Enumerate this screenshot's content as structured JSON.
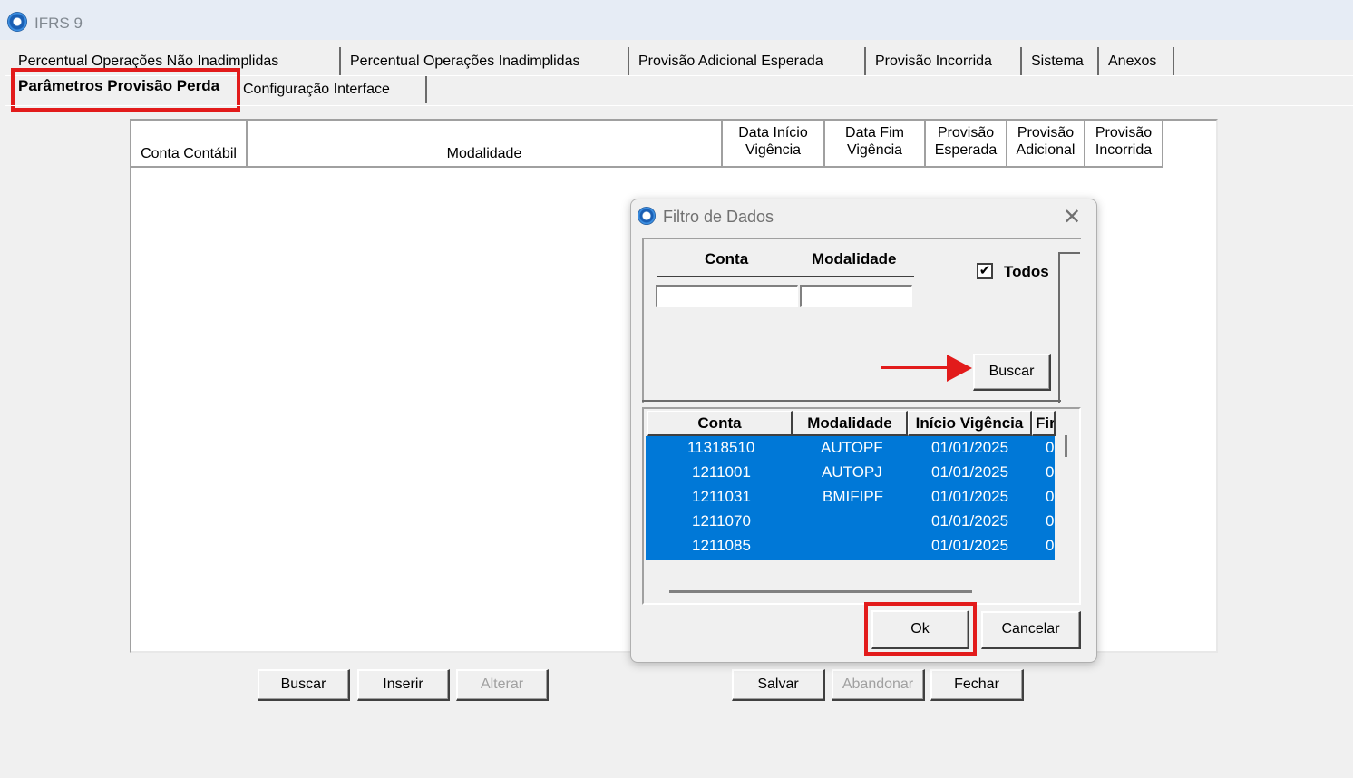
{
  "window": {
    "title": "IFRS 9"
  },
  "tabs": {
    "row1": [
      "Percentual Operações Não Inadimplidas",
      "Percentual Operações Inadimplidas",
      "Provisão Adicional Esperada",
      "Provisão Incorrida",
      "Sistema",
      "Anexos"
    ],
    "active": "Parâmetros Provisão Perda",
    "config": "Configuração Interface"
  },
  "grid": {
    "columns": {
      "conta": "Conta Contábil",
      "modalidade": "Modalidade",
      "inicio_1": "Data Início",
      "inicio_2": "Vigência",
      "fim_1": "Data Fim",
      "fim_2": "Vigência",
      "esperada_1": "Provisão",
      "esperada_2": "Esperada",
      "adicional_1": "Provisão",
      "adicional_2": "Adicional",
      "incorrida_1": "Provisão",
      "incorrida_2": "Incorrida"
    }
  },
  "bottom_buttons": {
    "buscar": "Buscar",
    "inserir": "Inserir",
    "alterar": "Alterar",
    "salvar": "Salvar",
    "abandonar": "Abandonar",
    "fechar": "Fechar"
  },
  "dialog": {
    "title": "Filtro de Dados",
    "close": "✕",
    "filter": {
      "conta_label": "Conta",
      "modalidade_label": "Modalidade",
      "conta_value": "",
      "modalidade_value": "",
      "todos_label": "Todos",
      "todos_checked": "✔",
      "buscar": "Buscar"
    },
    "list": {
      "headers": [
        "Conta",
        "Modalidade",
        "Início Vigência",
        "Fir"
      ],
      "rows": [
        {
          "conta": "11318510",
          "modalidade": "AUTOPF",
          "inicio": "01/01/2025",
          "fim": "0"
        },
        {
          "conta": "1211001",
          "modalidade": "AUTOPJ",
          "inicio": "01/01/2025",
          "fim": "0"
        },
        {
          "conta": "1211031",
          "modalidade": "BMIFIPF",
          "inicio": "01/01/2025",
          "fim": "0"
        },
        {
          "conta": "1211070",
          "modalidade": "",
          "inicio": "01/01/2025",
          "fim": "0"
        },
        {
          "conta": "1211085",
          "modalidade": "",
          "inicio": "01/01/2025",
          "fim": "0"
        }
      ]
    },
    "ok": "Ok",
    "cancelar": "Cancelar"
  },
  "colors": {
    "highlight": "#e21b1b",
    "selection": "#0078d7"
  }
}
